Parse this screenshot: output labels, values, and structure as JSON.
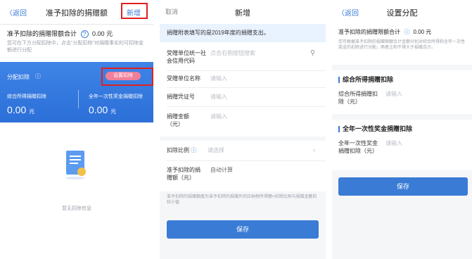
{
  "panel1": {
    "back": "〈返回",
    "title": "准予扣除的捐赠额",
    "add": "新增",
    "sum_label": "准予扣除的捐赠限额合计",
    "sum_value": "0.00 元",
    "desc": "您可在下方分配扣除中，点击\"分配扣除\"对捐赠事实的可扣除金额进行分配",
    "card_title": "分配扣除",
    "card_button": "设置扣除",
    "comp_label": "综合所得捐赠扣除",
    "comp_amount": "0.00",
    "unit": "元",
    "bonus_label": "全年一次性奖金捐赠扣除",
    "bonus_amount": "0.00",
    "empty_text": "暂无扣除信息"
  },
  "panel2": {
    "cancel": "取消",
    "title": "新增",
    "notice": "捐赠附表填写的是2019年度的捐赠支出。",
    "fields": [
      {
        "label": "受赠单位统一社会信用代码",
        "placeholder": "点击右侧按钮搜索"
      },
      {
        "label": "受赠单位名称",
        "placeholder": "请输入"
      },
      {
        "label": "捐赠凭证号",
        "placeholder": "请输入"
      },
      {
        "label": "捐赠金额（元）",
        "placeholder": "请输入"
      }
    ],
    "ratio_label": "扣除比例",
    "ratio_placeholder": "请选择",
    "deduct_label": "准予扣除的捐赠额（元）",
    "deduct_value": "自动计算",
    "footnote": "准予扣除的捐赠额度为准予扣除的捐赠外的应纳税所得额×扣除比例与捐赠金额的较小值",
    "save": "保存"
  },
  "panel3": {
    "back": "〈返回",
    "title": "设置分配",
    "sum_label": "准予扣除的捐赠限额合计",
    "sum_value": "0.00 元",
    "desc": "您可根据准予扣除的捐赠限额合计金额分别对综合所得和全年一次性奖金的扣除进行分配，两者之和不得大于捐赠合计。",
    "sect1": "综合所得捐赠扣除",
    "sect1_field": "综合所得捐赠扣除（元）",
    "sect2": "全年一次性奖金捐赠扣除",
    "sect2_field": "全年一次性奖金捐赠扣除（元）",
    "placeholder": "请输入",
    "save": "保存"
  }
}
